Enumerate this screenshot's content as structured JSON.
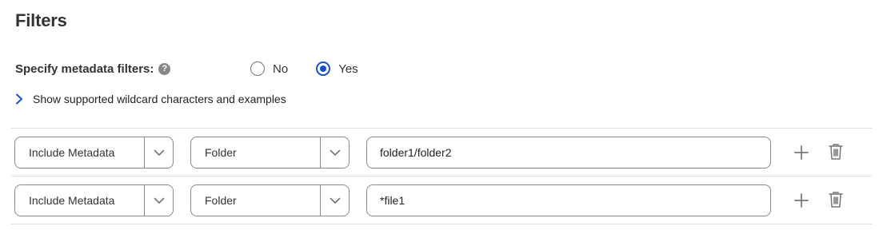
{
  "page": {
    "title": "Filters"
  },
  "metadata": {
    "label": "Specify metadata filters:",
    "help_icon": "help-icon",
    "help_glyph": "?",
    "options": [
      {
        "label": "No",
        "selected": false
      },
      {
        "label": "Yes",
        "selected": true
      }
    ]
  },
  "wildcard": {
    "label": "Show supported wildcard characters and examples",
    "icon": "chevron-right-icon"
  },
  "filters": [
    {
      "type": "Include Metadata",
      "field": "Folder",
      "value": "folder1/folder2"
    },
    {
      "type": "Include Metadata",
      "field": "Folder",
      "value": "*file1"
    }
  ],
  "colors": {
    "accent": "#1a4fc7",
    "border": "#8a8a8a",
    "divider": "#e0e0e0",
    "icon": "#757575"
  }
}
